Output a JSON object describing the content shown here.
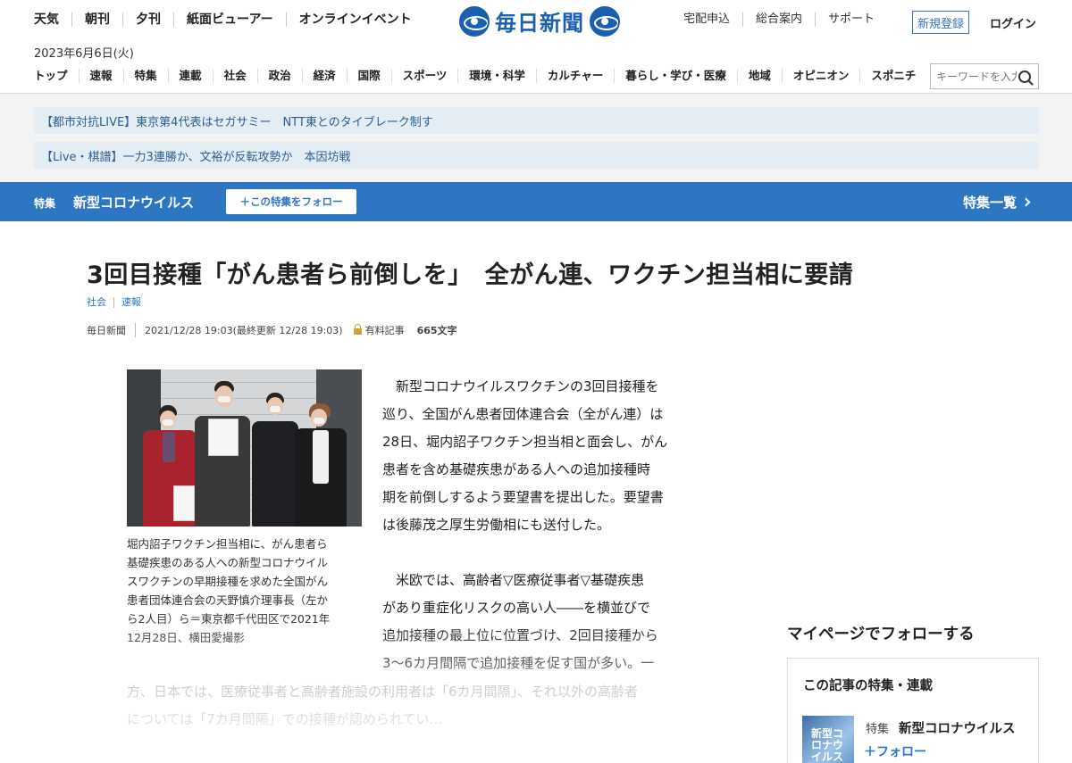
{
  "header": {
    "top_links": [
      "天気",
      "朝刊",
      "夕刊",
      "紙面ビューアー",
      "オンラインイベント"
    ],
    "logo_text": "毎日新聞",
    "right_links": [
      "宅配申込",
      "総合案内",
      "サポート"
    ],
    "register_label": "新規登録",
    "login_label": "ログイン",
    "date": "2023年6月6日(火)",
    "categories": [
      "トップ",
      "速報",
      "特集",
      "連載",
      "社会",
      "政治",
      "経済",
      "国際",
      "スポーツ",
      "環境・科学",
      "カルチャー",
      "暮らし・学び・医療",
      "地域",
      "オピニオン",
      "スポニチ"
    ],
    "search_placeholder": "キーワードを入力"
  },
  "breaking": [
    "【都市対抗LIVE】東京第4代表はセガサミー　NTT東とのタイブレーク制す",
    "【Live・棋譜】一力3連勝か、文裕が反転攻勢か　本因坊戦"
  ],
  "feature_bar": {
    "tag": "特集",
    "name": "新型コロナウイルス",
    "follow_label": "＋この特集をフォロー",
    "list_label": "特集一覧"
  },
  "article": {
    "headline": "3回目接種「がん患者ら前倒しを」　全がん連、ワクチン担当相に要請",
    "tags": [
      "社会",
      "速報"
    ],
    "source": "毎日新聞",
    "timestamp": "2021/12/28 19:03(最終更新 12/28 19:03)",
    "paid_label": "有料記事",
    "char_count": "665文字",
    "caption_lines": [
      "堀内詔子ワクチン担当相に、がん患者ら",
      "基礎疾患のある人への新型コロナウイル",
      "スワクチンの早期接種を求めた全国がん",
      "患者団体連合会の天野慎介理事長（左か",
      "ら2人目）ら＝東京都千代田区で2021年",
      "12月28日、横田愛撮影"
    ],
    "para1_lines": [
      "　新型コロナウイルスワクチンの3回目接種を",
      "巡り、全国がん患者団体連合会（全がん連）は",
      "28日、堀内詔子ワクチン担当相と面会し、がん",
      "患者を含め基礎疾患がある人への追加接種時",
      "期を前倒しするよう要望書を提出した。要望書",
      "は後藤茂之厚生労働相にも送付した。"
    ],
    "para2_lines": [
      "　米欧では、高齢者▽医療従事者▽基礎疾患",
      "があり重症化リスクの高い人――を横並びで",
      "追加接種の最上位に位置づけ、2回目接種から",
      "3～6カ月間隔で追加接種を促す国が多い。一"
    ],
    "wide_lines": [
      "方、日本では、医療従事者と高齢者施設の利用者は「6カ月間隔」、それ以外の高齢者",
      "については「7カ月間隔」での接種が認められてい…"
    ]
  },
  "sidebar": {
    "title": "マイページでフォローする",
    "box_title": "この記事の特集・連載",
    "thumb_text": "新型コロナウイルス",
    "item_tag": "特集",
    "item_name": "新型コロナウイルス",
    "follow_label": "＋フォロー"
  },
  "colors": {
    "accent_blue": "#2d76c2",
    "logo_blue": "#1a5fb0",
    "breaking_bg": "#e4ecf4",
    "breaking_text": "#2c5e95"
  }
}
